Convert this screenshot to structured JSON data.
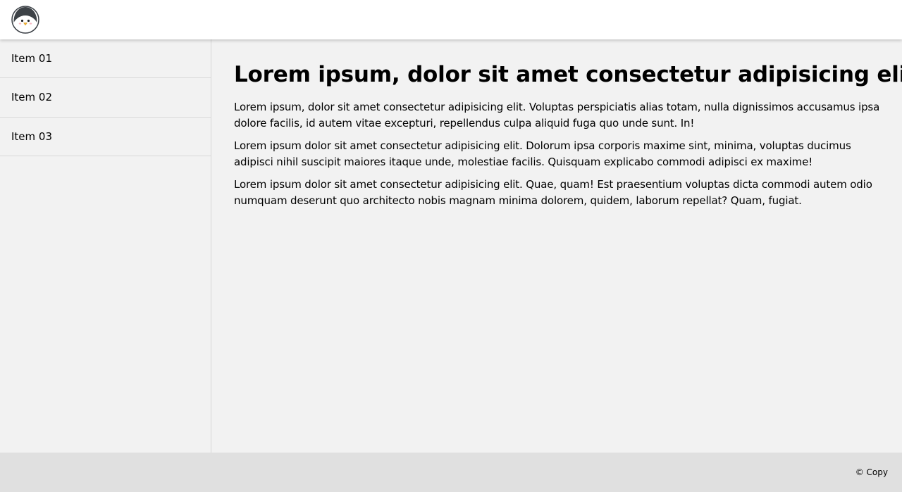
{
  "header": {
    "logo_icon": "penguin-avatar-icon"
  },
  "sidebar": {
    "items": [
      {
        "label": "Item 01"
      },
      {
        "label": "Item 02"
      },
      {
        "label": "Item 03"
      }
    ]
  },
  "main": {
    "title": "Lorem ipsum, dolor sit amet consectetur adipisicing elit.",
    "paragraphs": [
      "Lorem ipsum, dolor sit amet consectetur adipisicing elit. Voluptas perspiciatis alias totam, nulla dignissimos accusamus ipsa dolore facilis, id autem vitae excepturi, repellendus culpa aliquid fuga quo unde sunt. In!",
      "Lorem ipsum dolor sit amet consectetur adipisicing elit. Dolorum ipsa corporis maxime sint, minima, voluptas ducimus adipisci nihil suscipit maiores itaque unde, molestiae facilis. Quisquam explicabo commodi adipisci ex maxime!",
      "Lorem ipsum dolor sit amet consectetur adipisicing elit. Quae, quam! Est praesentium voluptas dicta commodi autem odio numquam deserunt quo architecto nobis magnam minima dolorem, quidem, laborum repellat? Quam, fugiat."
    ]
  },
  "footer": {
    "copy": "© Copy"
  },
  "colors": {
    "header_bg": "#ffffff",
    "body_bg": "#f2f2f2",
    "footer_bg": "#e0e0e0",
    "divider": "#d9d9d9"
  }
}
